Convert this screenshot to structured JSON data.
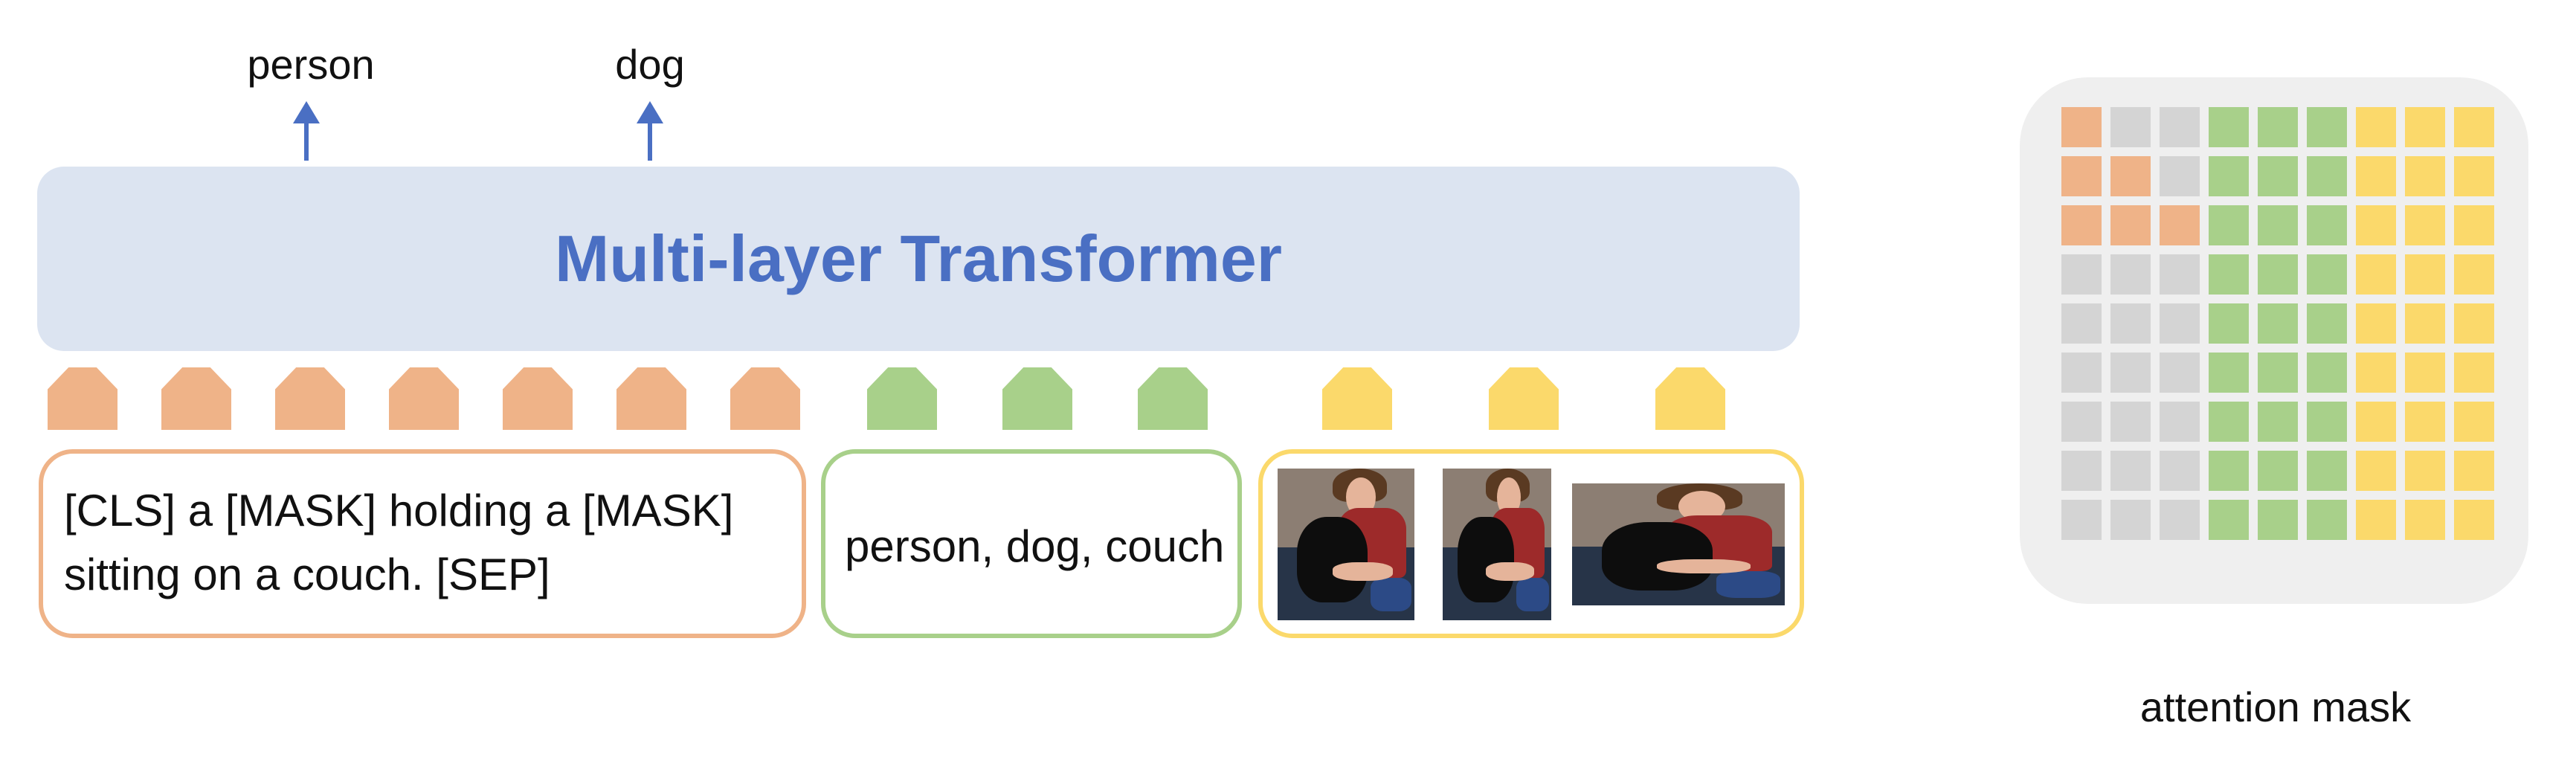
{
  "outputs": [
    {
      "label": "person"
    },
    {
      "label": "dog"
    }
  ],
  "transformer": {
    "title": "Multi-layer Transformer"
  },
  "inputs": {
    "text": {
      "line1": "[CLS]  a [MASK] holding a [MASK]",
      "line2": "sitting on a couch. [SEP]"
    },
    "tags": {
      "text": "person, dog, couch"
    },
    "regions": {
      "count": 3
    }
  },
  "tokens": {
    "text_count": 7,
    "tag_count": 3,
    "image_count": 3
  },
  "attention_mask": {
    "label": "attention mask",
    "rows": [
      [
        "o",
        "g",
        "g",
        "G",
        "G",
        "G",
        "y",
        "y",
        "y"
      ],
      [
        "o",
        "o",
        "g",
        "G",
        "G",
        "G",
        "y",
        "y",
        "y"
      ],
      [
        "o",
        "o",
        "o",
        "G",
        "G",
        "G",
        "y",
        "y",
        "y"
      ],
      [
        "g",
        "g",
        "g",
        "G",
        "G",
        "G",
        "y",
        "y",
        "y"
      ],
      [
        "g",
        "g",
        "g",
        "G",
        "G",
        "G",
        "y",
        "y",
        "y"
      ],
      [
        "g",
        "g",
        "g",
        "G",
        "G",
        "G",
        "y",
        "y",
        "y"
      ],
      [
        "g",
        "g",
        "g",
        "G",
        "G",
        "G",
        "y",
        "y",
        "y"
      ],
      [
        "g",
        "g",
        "g",
        "G",
        "G",
        "G",
        "y",
        "y",
        "y"
      ],
      [
        "g",
        "g",
        "g",
        "G",
        "G",
        "G",
        "y",
        "y",
        "y"
      ]
    ],
    "colors": {
      "o": "#efb388",
      "g": "#d4d4d4",
      "G": "#a8d08a",
      "y": "#fbd96b"
    }
  },
  "colors": {
    "accent_blue": "#4a6fc3",
    "transformer_bg": "#dce4f1",
    "text_token": "#efb388",
    "tag_token": "#a8d08a",
    "image_token": "#fbd96b"
  }
}
